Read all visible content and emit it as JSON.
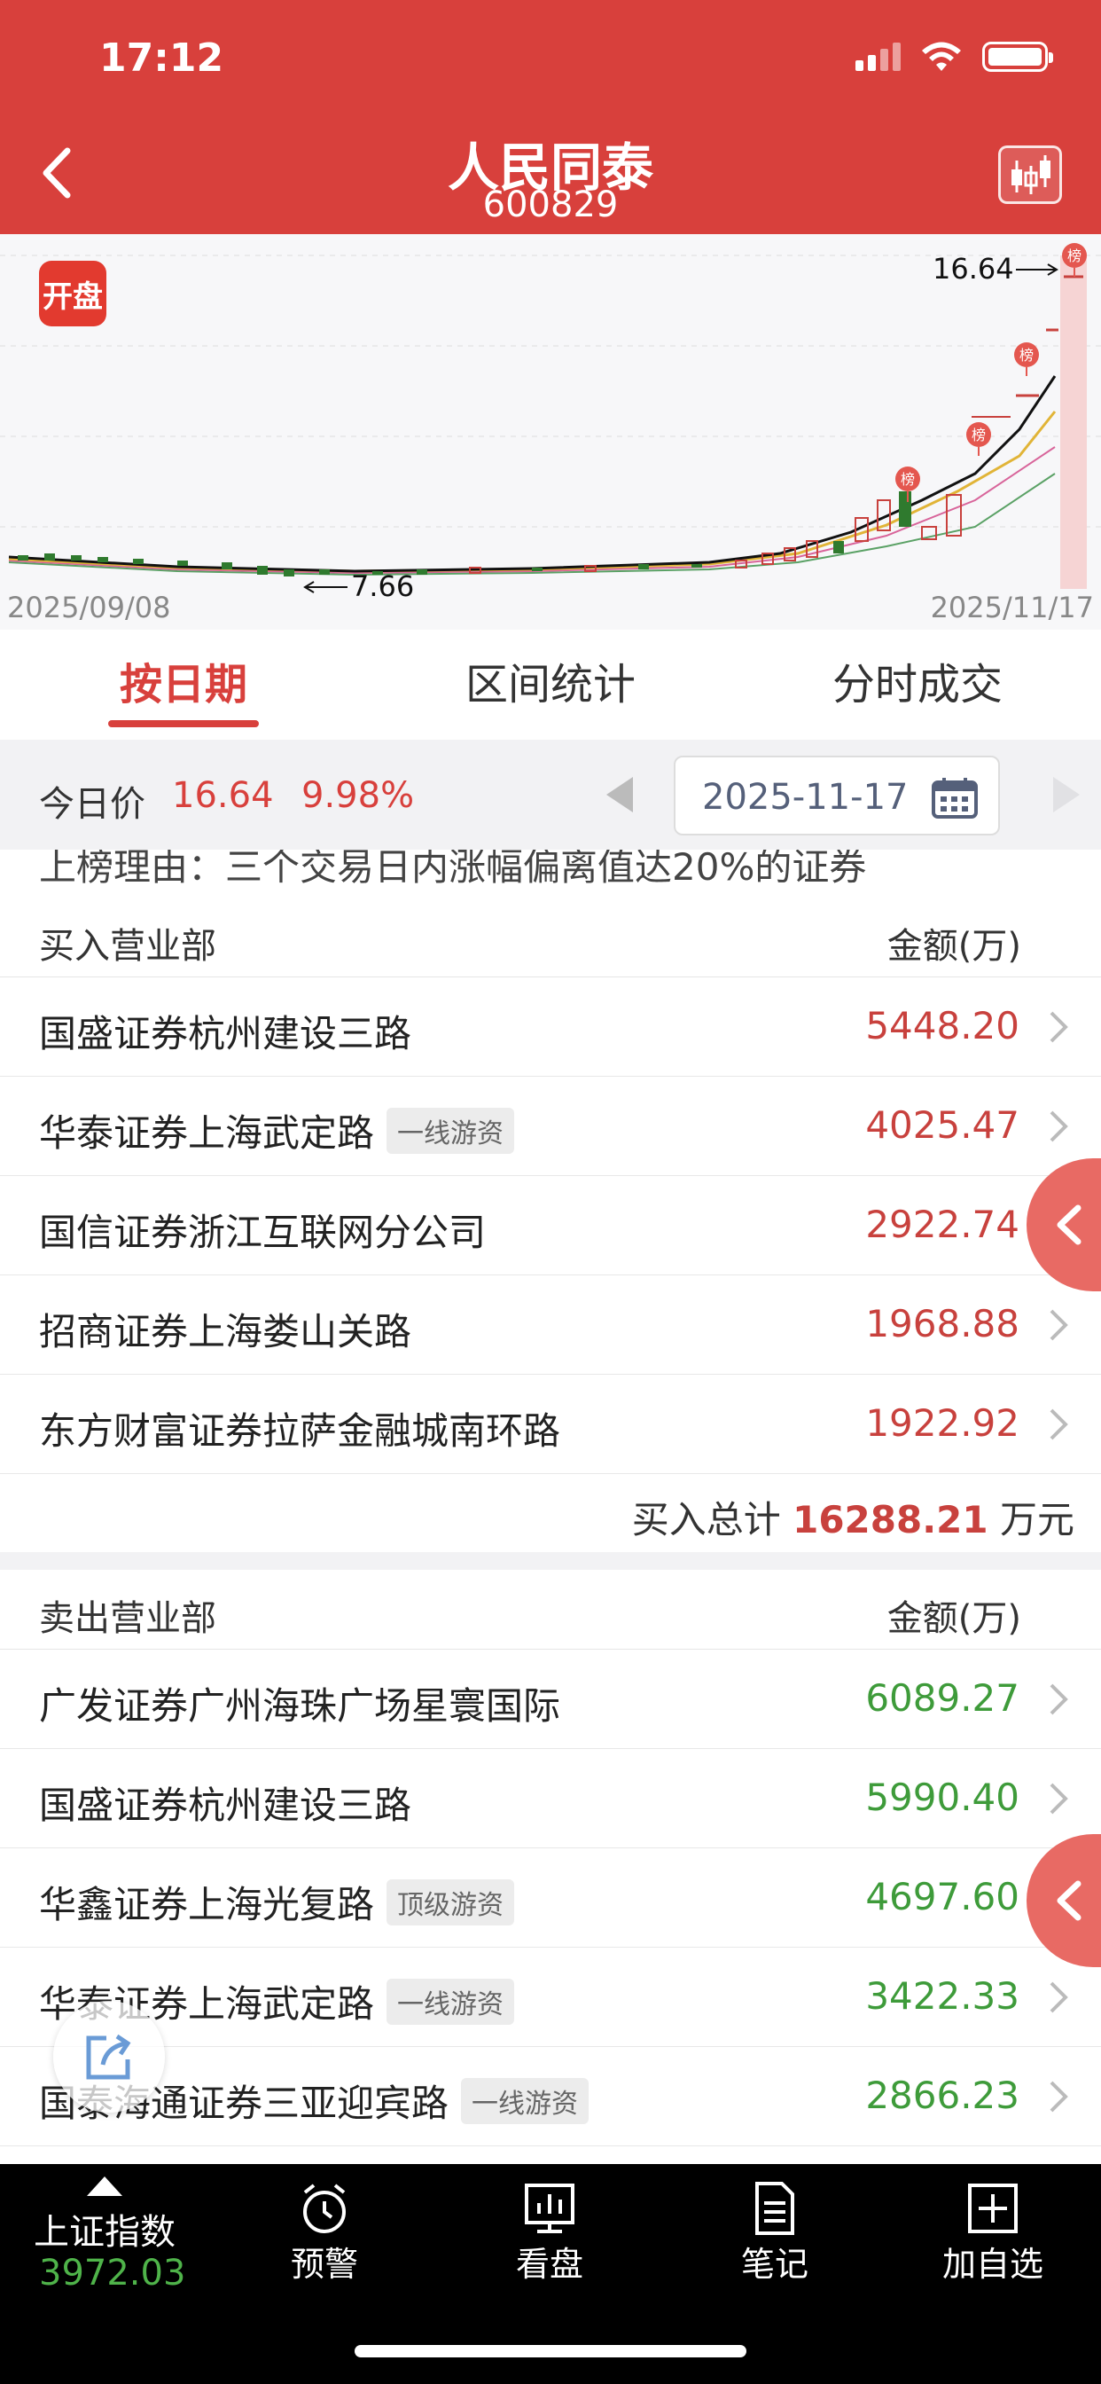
{
  "status": {
    "time": "17:12"
  },
  "header": {
    "title": "人民同泰",
    "code": "600829"
  },
  "chart": {
    "badge": "开盘",
    "max_label": "16.64",
    "min_label": "7.66",
    "start_date": "2025/09/08",
    "end_date": "2025/11/17",
    "marker_label": "榜"
  },
  "tabs": [
    {
      "label": "按日期"
    },
    {
      "label": "区间统计"
    },
    {
      "label": "分时成交"
    }
  ],
  "datebar": {
    "today_label": "今日价",
    "price": "16.64",
    "change": "9.98%",
    "date": "2025-11-17"
  },
  "reason": "上榜理由：三个交易日内涨幅偏离值达20%的证券",
  "buy": {
    "header_left": "买入营业部",
    "header_right": "金额(万)",
    "rows": [
      {
        "name": "国盛证券杭州建设三路",
        "tag": "",
        "value": "5448.20"
      },
      {
        "name": "华泰证券上海武定路",
        "tag": "一线游资",
        "value": "4025.47"
      },
      {
        "name": "国信证券浙江互联网分公司",
        "tag": "",
        "value": "2922.74"
      },
      {
        "name": "招商证券上海娄山关路",
        "tag": "",
        "value": "1968.88"
      },
      {
        "name": "东方财富证券拉萨金融城南环路",
        "tag": "",
        "value": "1922.92"
      }
    ],
    "total_label": "买入总计",
    "total_value": "16288.21",
    "total_unit": "万元"
  },
  "sell": {
    "header_left": "卖出营业部",
    "header_right": "金额(万)",
    "rows": [
      {
        "name": "广发证券广州海珠广场星寰国际",
        "tag": "",
        "value": "6089.27"
      },
      {
        "name": "国盛证券杭州建设三路",
        "tag": "",
        "value": "5990.40"
      },
      {
        "name": "华鑫证券上海光复路",
        "tag": "顶级游资",
        "value": "4697.60"
      },
      {
        "name": "华泰证券上海武定路",
        "tag": "一线游资",
        "value": "3422.33"
      },
      {
        "name": "国泰海通证券三亚迎宾路",
        "tag": "一线游资",
        "value": "2866.23"
      }
    ]
  },
  "bottom_nav": {
    "index_name": "上证指数",
    "index_value": "3972.03",
    "items": [
      {
        "label": "预警",
        "icon": "alarm-icon"
      },
      {
        "label": "看盘",
        "icon": "monitor-chart-icon"
      },
      {
        "label": "笔记",
        "icon": "note-icon"
      },
      {
        "label": "加自选",
        "icon": "plus-box-icon"
      }
    ]
  },
  "colors": {
    "brand_red": "#d8403c",
    "up": "#c8413d",
    "down": "#3e9b3a"
  }
}
